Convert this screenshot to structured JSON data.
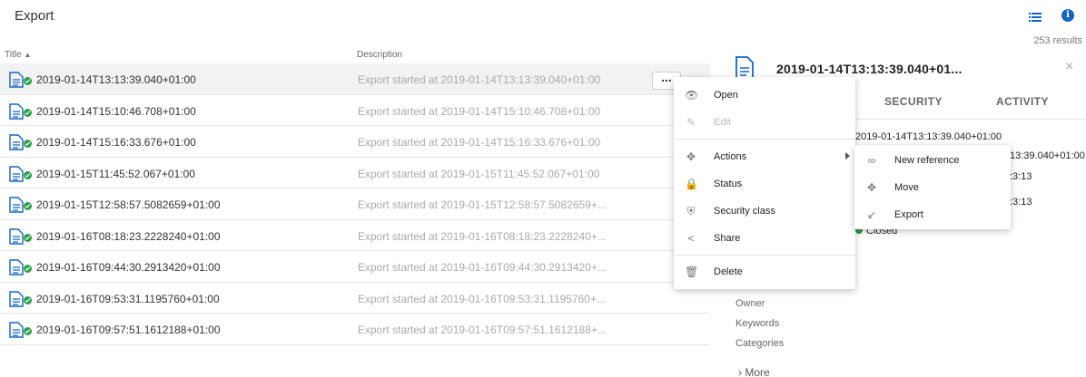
{
  "header": {
    "title": "Export",
    "results": "253 results",
    "info_glyph": "i"
  },
  "columns": {
    "title": "Title",
    "description": "Description",
    "sort_glyph": "▲"
  },
  "rows": [
    {
      "title": "2019-01-14T13:13:39.040+01:00",
      "description": "Export started at 2019-01-14T13:13:39.040+01:00"
    },
    {
      "title": "2019-01-14T15:10:46.708+01:00",
      "description": "Export started at 2019-01-14T15:10:46.708+01:00"
    },
    {
      "title": "2019-01-14T15:16:33.676+01:00",
      "description": "Export started at 2019-01-14T15:16:33.676+01:00"
    },
    {
      "title": "2019-01-15T11:45:52.067+01:00",
      "description": "Export started at 2019-01-15T11:45:52.067+01:00"
    },
    {
      "title": "2019-01-15T12:58:57.5082659+01:00",
      "description": "Export started at 2019-01-15T12:58:57.5082659+..."
    },
    {
      "title": "2019-01-16T08:18:23.2228240+01:00",
      "description": "Export started at 2019-01-16T08:18:23.2228240+..."
    },
    {
      "title": "2019-01-16T09:44:30.2913420+01:00",
      "description": "Export started at 2019-01-16T09:44:30.2913420+..."
    },
    {
      "title": "2019-01-16T09:53:31.1195760+01:00",
      "description": "Export started at 2019-01-16T09:53:31.1195760+..."
    },
    {
      "title": "2019-01-16T09:57:51.1612188+01:00",
      "description": "Export started at 2019-01-16T09:57:51.1612188+..."
    }
  ],
  "more_button": "...",
  "panel": {
    "title": "2019-01-14T13:13:39.040+01...",
    "close_glyph": "×",
    "tabs": [
      "SECURITY",
      "ACTIVITY"
    ],
    "values": [
      "2019-01-14T13:13:39.040+01:00",
      "13:39.040+01:00",
      ":3:13",
      ":3:13"
    ],
    "status": "Closed",
    "labels": [
      "Owner",
      "Keywords",
      "Categories"
    ],
    "more": "More",
    "more_glyph": "›"
  },
  "context_menu": {
    "items": [
      {
        "label": "Open",
        "icon": "eye-icon",
        "glyph": "👁"
      },
      {
        "label": "Edit",
        "icon": "pencil-icon",
        "glyph": "✎"
      },
      {
        "label": "Actions",
        "icon": "move-icon",
        "glyph": "✥"
      },
      {
        "label": "Status",
        "icon": "lock-icon",
        "glyph": "🔒"
      },
      {
        "label": "Security class",
        "icon": "shield-icon",
        "glyph": "⛨"
      },
      {
        "label": "Share",
        "icon": "share-icon",
        "glyph": "<"
      },
      {
        "label": "Delete",
        "icon": "trash-icon",
        "glyph": "🗑"
      }
    ]
  },
  "sub_menu": {
    "items": [
      {
        "label": "New reference",
        "icon": "link-icon",
        "glyph": "∞"
      },
      {
        "label": "Move",
        "icon": "move-icon",
        "glyph": "✥"
      },
      {
        "label": "Export",
        "icon": "export-icon",
        "glyph": "↙"
      }
    ]
  },
  "colors": {
    "accent": "#1565c0",
    "status_green": "#2e9e4a"
  }
}
